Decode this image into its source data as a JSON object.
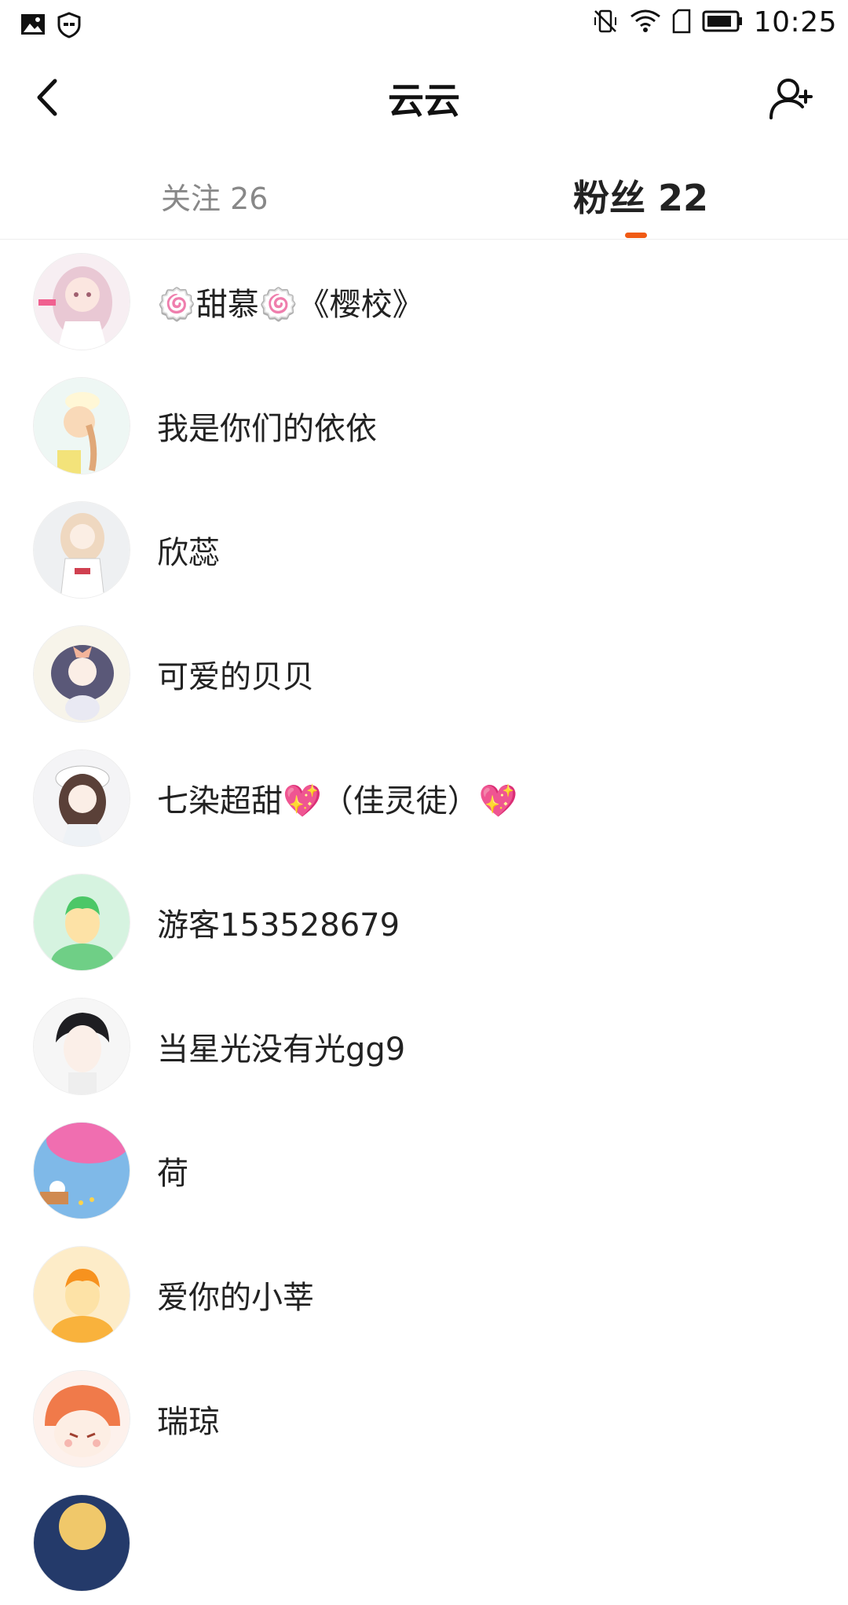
{
  "status_bar": {
    "time": "10:25",
    "icons": [
      "image-icon",
      "shield-icon",
      "vibrate-off-icon",
      "wifi-icon",
      "sim-card-icon",
      "battery-icon"
    ]
  },
  "header": {
    "title": "云云",
    "back_icon": "chevron-left-icon",
    "add_user_icon": "person-add-icon"
  },
  "tabs": {
    "following": "关注 26",
    "fans": "粉丝 22",
    "active": "fans",
    "accent_color": "#f05a14"
  },
  "fans": [
    {
      "name": "🍥甜慕🍥《樱校》",
      "avatar": "anime-girl-pink-avatar"
    },
    {
      "name": "我是你们的依依",
      "avatar": "anime-girl-braids-avatar"
    },
    {
      "name": "欣蕊",
      "avatar": "anime-girl-white-avatar"
    },
    {
      "name": "可爱的贝贝",
      "avatar": "anime-girl-bow-avatar"
    },
    {
      "name": "七染超甜💖（佳灵徒）💖",
      "avatar": "anime-girl-hat-avatar"
    },
    {
      "name": "游客153528679",
      "avatar": "default-green-avatar"
    },
    {
      "name": "当星光没有光gg9",
      "avatar": "anime-boy-avatar"
    },
    {
      "name": "荷",
      "avatar": "pink-flowers-avatar"
    },
    {
      "name": "爱你的小莘",
      "avatar": "default-orange-avatar"
    },
    {
      "name": "瑞琼",
      "avatar": "anime-orange-hood-avatar"
    }
  ]
}
